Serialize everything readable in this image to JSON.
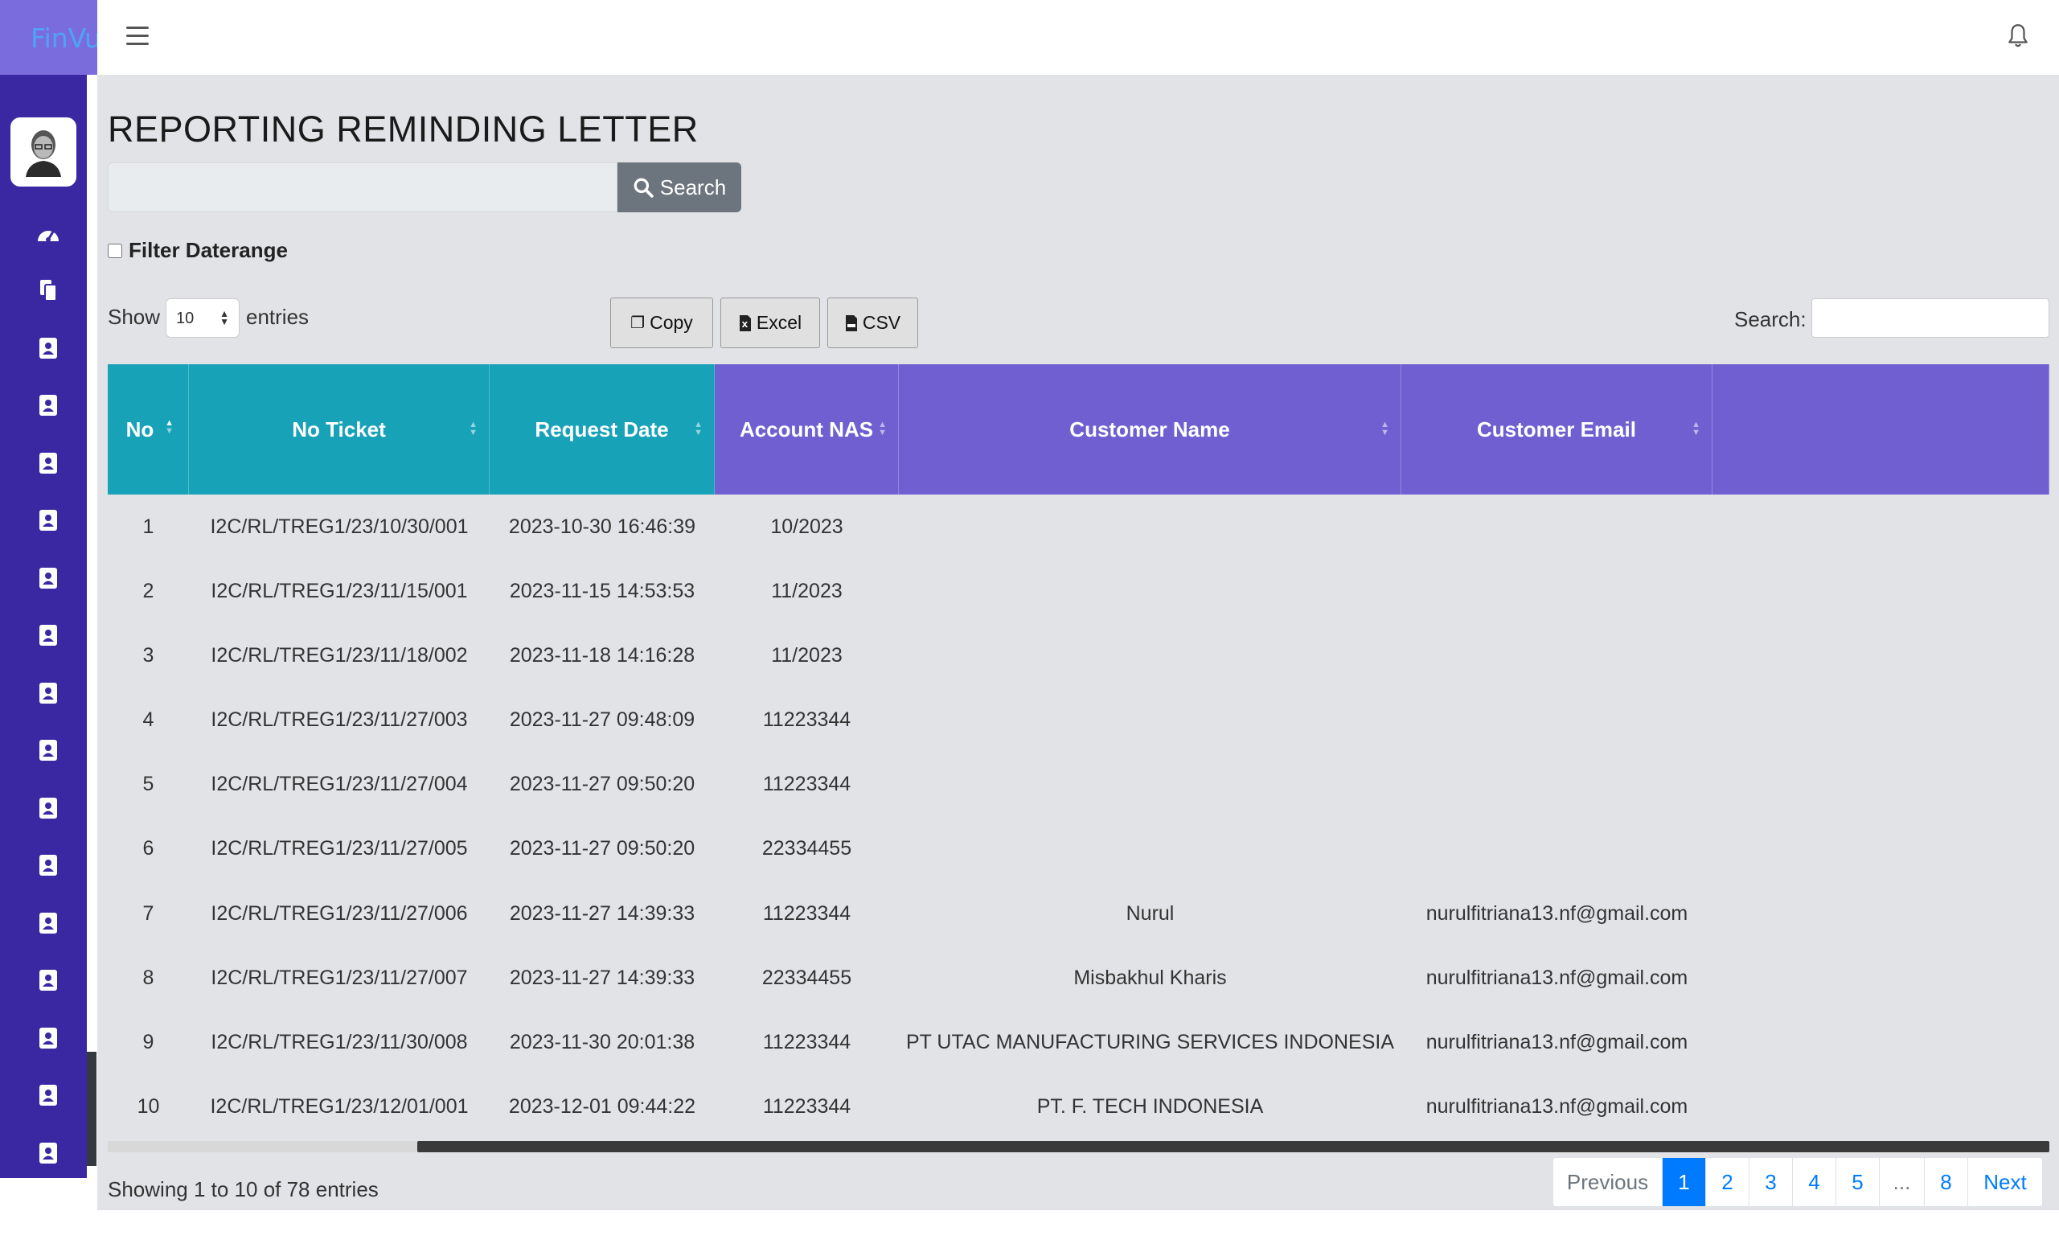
{
  "app": {
    "logo": "FinVu"
  },
  "page": {
    "title": "REPORTING REMINDING LETTER"
  },
  "search": {
    "placeholder": "",
    "button": "Search"
  },
  "filter": {
    "label": "Filter Daterange",
    "checked": false
  },
  "length": {
    "show": "Show",
    "value": "10",
    "entries": "entries"
  },
  "buttons": {
    "copy": "Copy",
    "excel": "Excel",
    "csv": "CSV"
  },
  "dt_search": {
    "label": "Search:"
  },
  "table": {
    "headers": [
      "No",
      "No Ticket",
      "Request Date",
      "Account NAS",
      "Customer Name",
      "Customer Email",
      ""
    ],
    "rows": [
      [
        "1",
        "I2C/RL/TREG1/23/10/30/001",
        "2023-10-30 16:46:39",
        "10/2023",
        "",
        ""
      ],
      [
        "2",
        "I2C/RL/TREG1/23/11/15/001",
        "2023-11-15 14:53:53",
        "11/2023",
        "",
        ""
      ],
      [
        "3",
        "I2C/RL/TREG1/23/11/18/002",
        "2023-11-18 14:16:28",
        "11/2023",
        "",
        ""
      ],
      [
        "4",
        "I2C/RL/TREG1/23/11/27/003",
        "2023-11-27 09:48:09",
        "11223344",
        "",
        ""
      ],
      [
        "5",
        "I2C/RL/TREG1/23/11/27/004",
        "2023-11-27 09:50:20",
        "11223344",
        "",
        ""
      ],
      [
        "6",
        "I2C/RL/TREG1/23/11/27/005",
        "2023-11-27 09:50:20",
        "22334455",
        "",
        ""
      ],
      [
        "7",
        "I2C/RL/TREG1/23/11/27/006",
        "2023-11-27 14:39:33",
        "11223344",
        "Nurul",
        "nurulfitriana13.nf@gmail.com"
      ],
      [
        "8",
        "I2C/RL/TREG1/23/11/27/007",
        "2023-11-27 14:39:33",
        "22334455",
        "Misbakhul Kharis",
        "nurulfitriana13.nf@gmail.com"
      ],
      [
        "9",
        "I2C/RL/TREG1/23/11/30/008",
        "2023-11-30 20:01:38",
        "11223344",
        "PT UTAC MANUFACTURING SERVICES INDONESIA",
        "nurulfitriana13.nf@gmail.com"
      ],
      [
        "10",
        "I2C/RL/TREG1/23/12/01/001",
        "2023-12-01 09:44:22",
        "11223344",
        "PT. F. TECH INDONESIA",
        "nurulfitriana13.nf@gmail.com"
      ]
    ]
  },
  "info": "Showing 1 to 10 of 78 entries",
  "pagination": {
    "items": [
      "Previous",
      "1",
      "2",
      "3",
      "4",
      "5",
      "...",
      "8",
      "Next"
    ],
    "active": "1"
  },
  "colors": {
    "sidebar": "#3a28a3",
    "logo_bg": "#7b6cde",
    "header_teal": "#17a2b8",
    "header_purple": "#6f5fd1",
    "page_bg": "#e2e3e6",
    "active_page": "#007bff"
  },
  "icons": {
    "sidebar": [
      "gauge-icon",
      "files-icon",
      "contact-card-icon"
    ],
    "header": [
      "menu-icon",
      "bell-icon"
    ]
  }
}
